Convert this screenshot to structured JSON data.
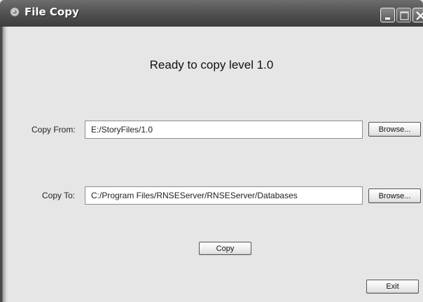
{
  "window": {
    "title": "File Copy"
  },
  "main": {
    "heading": "Ready to copy level 1.0",
    "copy_from": {
      "label": "Copy From:",
      "value": "E:/StoryFiles/1.0",
      "browse_label": "Browse..."
    },
    "copy_to": {
      "label": "Copy To:",
      "value": "C:/Program Files/RNSEServer/RNSEServer/Databases",
      "browse_label": "Browse..."
    },
    "copy_button_label": "Copy",
    "exit_button_label": "Exit"
  },
  "icons": {
    "app": "app-icon",
    "minimize": "minimize-icon",
    "maximize": "maximize-icon",
    "close": "close-icon"
  }
}
